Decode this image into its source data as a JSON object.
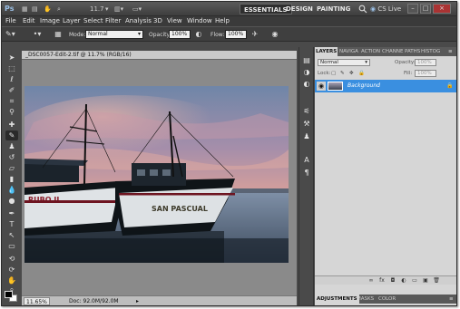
{
  "app": {
    "logo": "Ps",
    "zoom_value": "11.7",
    "workspaces": [
      "ESSENTIALS",
      "DESIGN",
      "PAINTING",
      "»"
    ],
    "cs_live": "CS Live",
    "window_controls": [
      "–",
      "□",
      "×"
    ]
  },
  "menu": [
    "File",
    "Edit",
    "Image",
    "Layer",
    "Select",
    "Filter",
    "Analysis",
    "3D",
    "View",
    "Window",
    "Help"
  ],
  "options": {
    "mode_label": "Mode:",
    "mode_value": "Normal",
    "opacity_label": "Opacity:",
    "opacity_value": "100%",
    "flow_label": "Flow:",
    "flow_value": "100%"
  },
  "document": {
    "tab_title": "_DSC0057-Edit-2.tif @ 11.7% (RGB/16)",
    "status_zoom": "11.65%",
    "status_doc": "Doc: 92.0M/92.0M"
  },
  "layers_panel": {
    "tabs": [
      "LAYERS",
      "NAVIGA",
      "ACTION",
      "CHANNE",
      "PATHS",
      "HISTOG"
    ],
    "blend_mode": "Normal",
    "opacity_label": "Opacity:",
    "opacity_value": "100%",
    "lock_label": "Lock:",
    "fill_label": "Fill:",
    "fill_value": "100%",
    "layer_name": "Background"
  },
  "bottom_tabs": [
    "ADJUSTMENTS",
    "MASKS",
    "COLOR"
  ],
  "colors": {
    "accent": "#3a8fe0",
    "app_bg": "#4a4a4a",
    "panel_bg": "#d6d6d6"
  }
}
